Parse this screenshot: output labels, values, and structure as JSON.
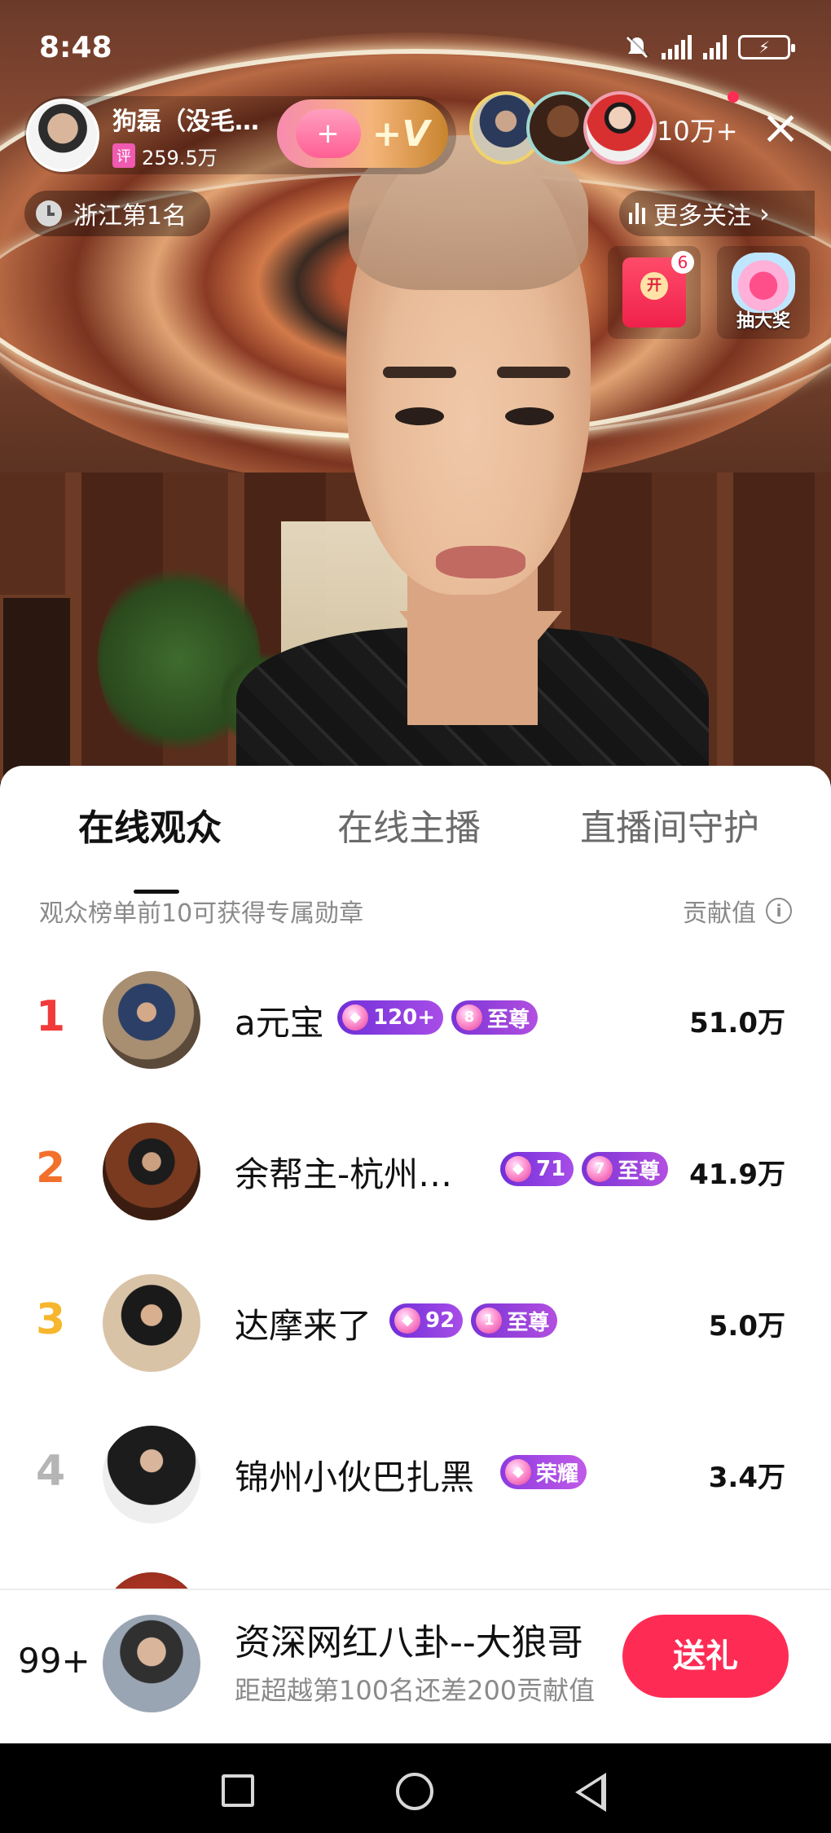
{
  "status_bar": {
    "time": "8:48",
    "icons": [
      "mute-icon",
      "signal-icon",
      "signal-icon",
      "battery-charging-icon"
    ]
  },
  "anchor": {
    "name": "狗磊（没毛…",
    "badge": "评",
    "followers": "259.5万"
  },
  "follow_button": {
    "plus": "+",
    "v": "+V"
  },
  "viewers": {
    "count": "10万+"
  },
  "rank_pill": {
    "label": "浙江第1名"
  },
  "more_follow": {
    "label": "更多关注"
  },
  "red_packet": {
    "coin": "开",
    "count": "6"
  },
  "lottery": {
    "label": "抽大奖"
  },
  "sheet": {
    "tabs": [
      {
        "label": "在线观众",
        "active": true
      },
      {
        "label": "在线主播",
        "active": false
      },
      {
        "label": "直播间守护",
        "active": false
      }
    ],
    "subtitle": "观众榜单前10可获得专属勋章",
    "contribution_label": "贡献值",
    "rows": [
      {
        "rank": "1",
        "name": "a元宝",
        "level": "120+",
        "vip_num": "8",
        "vip": "至尊",
        "value": "51.0万"
      },
      {
        "rank": "2",
        "name": "余帮主-杭州…",
        "level": "71",
        "vip_num": "7",
        "vip": "至尊",
        "value": "41.9万"
      },
      {
        "rank": "3",
        "name": "达摩来了",
        "level": "92",
        "vip_num": "1",
        "vip": "至尊",
        "value": "5.0万"
      },
      {
        "rank": "4",
        "name": "锦州小伙巴扎黑",
        "glory": "荣耀",
        "value": "3.4万"
      }
    ],
    "colors": {
      "rank1": "#f23a3a",
      "rank2": "#f2702b",
      "rank3": "#f6b62d",
      "rank_other": "#b5b5b5",
      "accent": "#fe2c55"
    }
  },
  "my_bar": {
    "rank": "99+",
    "name": "资深网红八卦--大狼哥",
    "hint": "距超越第100名还差200贡献值",
    "gift_button": "送礼"
  }
}
